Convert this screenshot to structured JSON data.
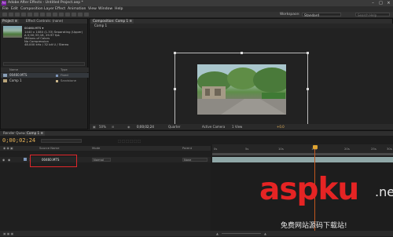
{
  "window": {
    "title": "Adobe After Effects - Untitled Project.aep *",
    "logo": "Ae"
  },
  "menu": [
    "File",
    "Edit",
    "Composition",
    "Layer",
    "Effect",
    "Animation",
    "View",
    "Window",
    "Help"
  ],
  "toolbar": {
    "workspace_label": "Workspace:",
    "workspace_value": "Standard",
    "search_placeholder": "Search Help"
  },
  "project": {
    "tabs": [
      "Project ≡",
      "Effect Controls: (none)"
    ],
    "file_name": "00460.MTS ▾",
    "meta": [
      "1440 x 1080 (1.33) Separating (Upper)",
      "Δ 0;00;33;18, 29.97 fps",
      "Millions of Colors",
      "No Compression",
      "48.000 kHz / 32 bit U / Stereo"
    ],
    "columns": {
      "name": "Name",
      "type": "Type"
    },
    "items": [
      {
        "name": "00460.MTS",
        "type": "Fixed",
        "swatch": "#7c94b8",
        "icon": "footage-icon"
      },
      {
        "name": "Comp 1",
        "type": "Sandstone",
        "swatch": "#c8b48a",
        "icon": "composition-icon"
      }
    ],
    "footer": "8 bpc"
  },
  "composition": {
    "tab": "Composition: Comp 1 ≡",
    "breadcrumb": "Comp 1",
    "footer": {
      "zoom": "50%",
      "timecode": "0;00;02;24",
      "resolution": "Quarter",
      "camera": "Active Camera",
      "views": "1 View",
      "exposure": "+0.0"
    }
  },
  "timeline": {
    "tabs": [
      "Render Queue",
      "Comp 1 ≡"
    ],
    "timecode": "0;00;02;24",
    "columns": {
      "source": "Source Name",
      "mode": "Mode",
      "parent": "Parent"
    },
    "ruler_ticks": [
      "0s",
      "5s",
      "10s",
      "15s",
      "20s",
      "25s",
      "30s"
    ],
    "layer": {
      "index": "1",
      "name": "00460.MTS",
      "mode": "Normal",
      "parent": "None"
    }
  },
  "watermark": {
    "main": "aspku",
    "tld": ".net",
    "sub": "免费网站源码下载站!"
  },
  "colors": {
    "accent_timecode": "#e6b35a",
    "playhead": "#e0a431",
    "highlight_box": "#e0262a",
    "layer_bar": "#8fa7a7",
    "watermark_red": "#e52424"
  }
}
